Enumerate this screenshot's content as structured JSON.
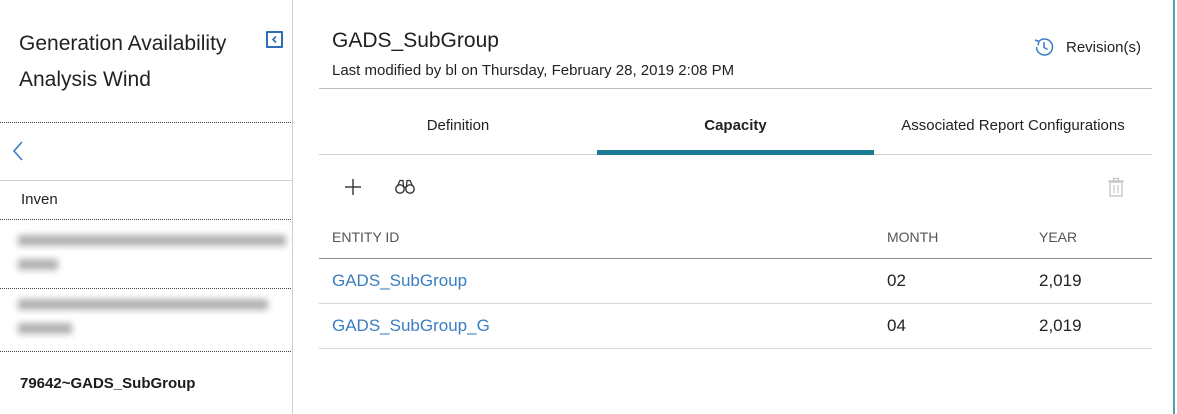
{
  "sidebar": {
    "title_line1": "Generation Availability",
    "title_line2": "Analysis Wind",
    "list_header": "Inven",
    "selected_item": "79642~GADS_SubGroup"
  },
  "record": {
    "title": "GADS_SubGroup",
    "last_modified": "Last modified by bl on Thursday, February 28, 2019 2:08 PM",
    "revisions_label": "Revision(s)"
  },
  "tabs": [
    {
      "label": "Definition",
      "active": false
    },
    {
      "label": "Capacity",
      "active": true
    },
    {
      "label": "Associated Report Configurations",
      "active": false
    }
  ],
  "toolbar": {
    "icons": [
      "plus-icon",
      "binoculars-icon",
      "trash-icon"
    ]
  },
  "grid": {
    "columns": [
      "ENTITY ID",
      "MONTH",
      "YEAR"
    ],
    "rows": [
      {
        "entity_id": "GADS_SubGroup",
        "month": "02",
        "year": "2,019"
      },
      {
        "entity_id": "GADS_SubGroup_G",
        "month": "04",
        "year": "2,019"
      }
    ]
  },
  "colors": {
    "accent": "#1b7c93",
    "link": "#3a7ec1",
    "icon_blue": "#2a6fb5"
  }
}
